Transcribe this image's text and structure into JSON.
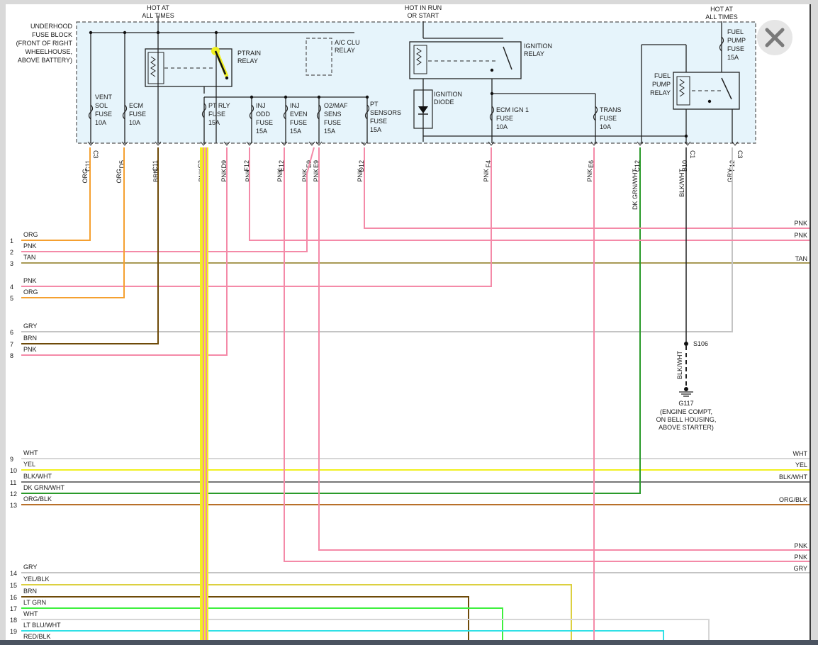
{
  "viewer": {
    "close_icon": "close-icon"
  },
  "colors": {
    "ORG": "#f5a030",
    "PNK": "#f48aa8",
    "TAN": "#a89a55",
    "BRN": "#6e4a08",
    "GRY": "#c4c4c4",
    "WHT": "#d6d6d6",
    "YEL": "#f0f020",
    "BLKWHT": "#777777",
    "DKGRNWHT": "#2a9a2a",
    "ORGBLK": "#b8702a",
    "YELBLK": "#dcd040",
    "LTGRN": "#3ef03e",
    "LTBLUWHT": "#30e0e6",
    "REDBLK": "#ee3030",
    "box": "#e6f4fb",
    "line": "#222222"
  },
  "header": {
    "hot1": [
      "HOT AT",
      "ALL TIMES"
    ],
    "hotrun": [
      "HOT IN RUN",
      "OR START"
    ],
    "hot2": [
      "HOT AT",
      "ALL TIMES"
    ]
  },
  "fuse_block": [
    "UNDERHOOD",
    "FUSE BLOCK",
    "(FRONT OF RIGHT",
    "WHEELHOUSE,",
    "ABOVE BATTERY)"
  ],
  "components": {
    "ptrain_relay": [
      "PTRAIN",
      "RELAY"
    ],
    "ac_clu_relay": [
      "A/C CLU",
      "RELAY"
    ],
    "ignition_relay": [
      "IGNITION",
      "RELAY"
    ],
    "ignition_diode": [
      "IGNITION",
      "DIODE"
    ],
    "fuel_pump_relay": [
      "FUEL",
      "PUMP",
      "RELAY"
    ],
    "fuel_pump_fuse": [
      "FUEL",
      "PUMP",
      "FUSE",
      "15A"
    ],
    "vent_sol_fuse": [
      "VENT",
      "SOL",
      "FUSE",
      "10A"
    ],
    "ecm_fuse": [
      "ECM",
      "FUSE",
      "10A"
    ],
    "pt_rly_fuse": [
      "PT RLY",
      "FUSE",
      "15A"
    ],
    "inj_odd_fuse": [
      "INJ",
      "ODD",
      "FUSE",
      "15A"
    ],
    "inj_even_fuse": [
      "INJ",
      "EVEN",
      "FUSE",
      "15A"
    ],
    "o2_maf_fuse": [
      "O2/MAF",
      "SENS",
      "FUSE",
      "15A"
    ],
    "pt_sensors_fuse": [
      "PT",
      "SENSORS",
      "FUSE",
      "15A"
    ],
    "ecm_ign1_fuse": [
      "ECM IGN 1",
      "FUSE",
      "10A"
    ],
    "trans_fuse": [
      "TRANS",
      "FUSE",
      "10A"
    ]
  },
  "connector_labels": [
    {
      "pin": "C11",
      "conn": "C3",
      "wire": "ORG"
    },
    {
      "pin": "D5",
      "conn": "",
      "wire": "ORG"
    },
    {
      "pin": "C11",
      "conn": "",
      "wire": "BRN"
    },
    {
      "pin": "C3",
      "conn": "",
      "wire": "PNK"
    },
    {
      "pin": "D9",
      "conn": "",
      "wire": "PNK"
    },
    {
      "pin": "F12",
      "conn": "",
      "wire": "PNK"
    },
    {
      "pin": "E12",
      "conn": "",
      "wire": "PNK"
    },
    {
      "pin": "E9",
      "conn": "",
      "wire": "PNK"
    },
    {
      "pin": "E9",
      "conn": "",
      "wire": "PNK"
    },
    {
      "pin": "D12",
      "conn": "",
      "wire": "PNK"
    },
    {
      "pin": "F4",
      "conn": "",
      "wire": "PNK"
    },
    {
      "pin": "E6",
      "conn": "",
      "wire": "PNK"
    },
    {
      "pin": "C12",
      "conn": "",
      "wire": "DK GRN/WHT"
    },
    {
      "pin": "B10",
      "conn": "C1",
      "wire": "BLK/WHT"
    },
    {
      "pin": "F12",
      "conn": "C3",
      "wire": "GRY"
    }
  ],
  "splice": {
    "label": "S106",
    "wire": "BLK/WHT"
  },
  "ground": {
    "label": "G117",
    "desc": [
      "(ENGINE COMPT,",
      "ON BELL HOUSING,",
      "ABOVE STARTER)"
    ]
  },
  "left_lines": [
    {
      "num": "1",
      "label": "ORG"
    },
    {
      "num": "2",
      "label": "PNK"
    },
    {
      "num": "3",
      "label": "TAN"
    },
    {
      "num": "4",
      "label": "PNK"
    },
    {
      "num": "5",
      "label": "ORG"
    },
    {
      "num": "6",
      "label": "GRY"
    },
    {
      "num": "7",
      "label": "BRN"
    },
    {
      "num": "8",
      "label": "PNK"
    },
    {
      "num": "9",
      "label": "WHT"
    },
    {
      "num": "10",
      "label": "YEL"
    },
    {
      "num": "11",
      "label": "BLK/WHT"
    },
    {
      "num": "12",
      "label": "DK GRN/WHT"
    },
    {
      "num": "13",
      "label": "ORG/BLK"
    },
    {
      "num": "14",
      "label": "GRY"
    },
    {
      "num": "15",
      "label": "YEL/BLK"
    },
    {
      "num": "16",
      "label": "BRN"
    },
    {
      "num": "17",
      "label": "LT GRN"
    },
    {
      "num": "18",
      "label": "WHT"
    },
    {
      "num": "19",
      "label": "LT BLU/WHT"
    },
    {
      "num": "",
      "label": "RED/BLK"
    }
  ],
  "right_labels": [
    "PNK",
    "PNK",
    "TAN",
    "WHT",
    "YEL",
    "BLK/WHT",
    "ORG/BLK",
    "PNK",
    "PNK",
    "GRY"
  ]
}
